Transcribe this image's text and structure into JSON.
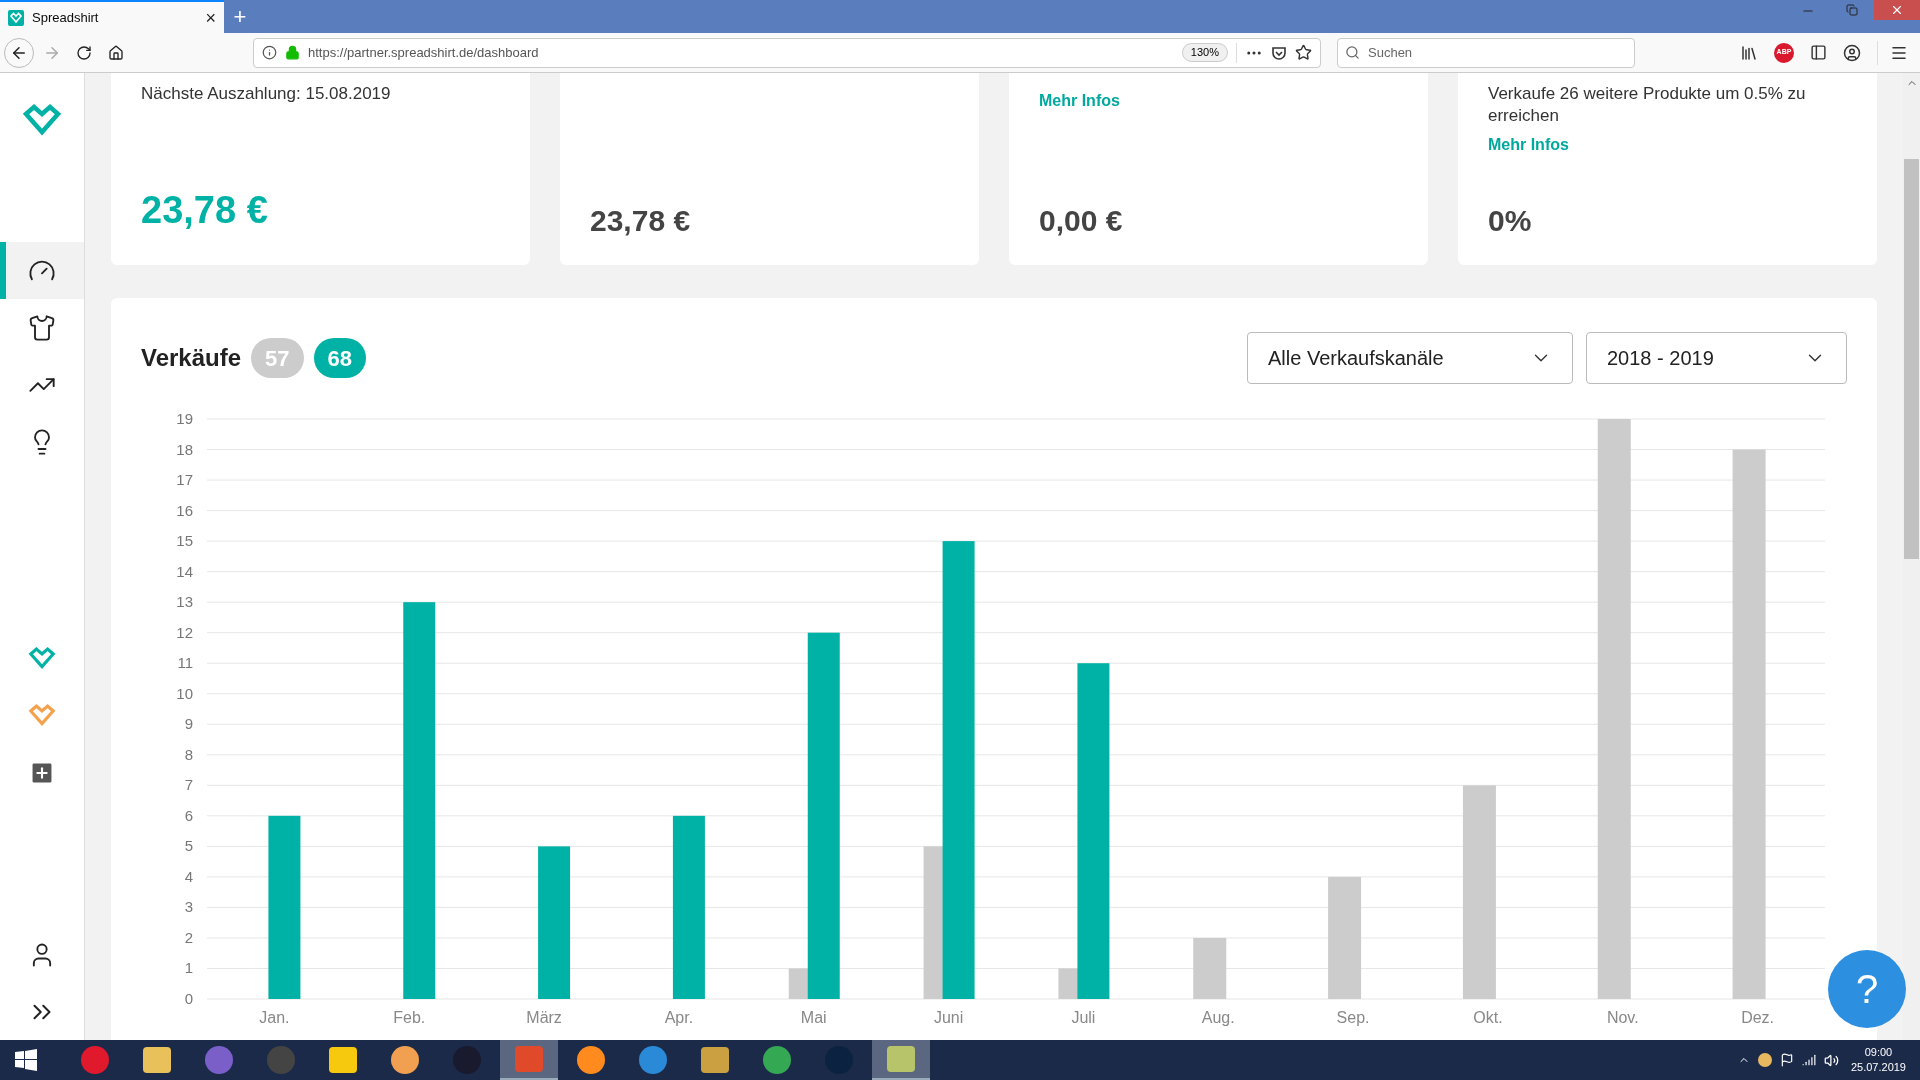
{
  "browser": {
    "tab": {
      "title": "Spreadshirt",
      "close": "×"
    },
    "new_tab": "+",
    "url": "https://partner.spreadshirt.de/dashboard",
    "zoom": "130%",
    "search": {
      "placeholder": "Suchen"
    },
    "abp": "ABP"
  },
  "sidebar": {
    "nav": [
      {
        "selected": true
      },
      {
        "selected": false
      },
      {
        "selected": false
      },
      {
        "selected": false
      }
    ]
  },
  "cards": [
    {
      "text": "Nächste Auszahlung: 15.08.2019",
      "value": "23,78 €",
      "highlighted": true
    },
    {
      "value": "23,78 €",
      "highlighted": false
    },
    {
      "link": "Mehr Infos",
      "value": "0,00 €",
      "highlighted": false
    },
    {
      "text": "Verkaufe 26 weitere Produkte um 0.5% zu erreichen",
      "link": "Mehr Infos",
      "value": "0%",
      "highlighted": false
    }
  ],
  "sales": {
    "title": "Verkäufe",
    "badges": [
      "57",
      "68"
    ],
    "filters": [
      {
        "value": "Alle Verkaufskanäle"
      },
      {
        "value": "2018 - 2019"
      }
    ],
    "chart_data": {
      "type": "bar",
      "categories": [
        "Jan.",
        "Feb.",
        "März",
        "Apr.",
        "Mai",
        "Juni",
        "Juli",
        "Aug.",
        "Sep.",
        "Okt.",
        "Nov.",
        "Dez."
      ],
      "series": [
        {
          "color": "#cccccc",
          "values": [
            0,
            0,
            0,
            0,
            1,
            5,
            1,
            2,
            4,
            7,
            19,
            18
          ]
        },
        {
          "color": "#00b2a5",
          "values": [
            6,
            13,
            5,
            6,
            12,
            15,
            11,
            null,
            null,
            null,
            null,
            null
          ]
        }
      ],
      "grid": true,
      "ylim": [
        0,
        19
      ],
      "yticks": [
        0,
        1,
        2,
        3,
        4,
        5,
        6,
        7,
        8,
        9,
        10,
        11,
        12,
        13,
        14,
        15,
        16,
        17,
        18,
        19
      ]
    }
  },
  "help": "?",
  "taskbar": {
    "apps": [
      {
        "selected": false
      },
      {
        "selected": false
      },
      {
        "selected": false
      },
      {
        "selected": false
      },
      {
        "selected": false
      },
      {
        "selected": false
      },
      {
        "selected": false
      },
      {
        "selected": true
      },
      {
        "selected": false
      },
      {
        "selected": false
      },
      {
        "selected": false
      },
      {
        "selected": false
      },
      {
        "selected": false
      },
      {
        "selected": true
      }
    ],
    "time": "09:00",
    "date": "25.07.2019"
  }
}
